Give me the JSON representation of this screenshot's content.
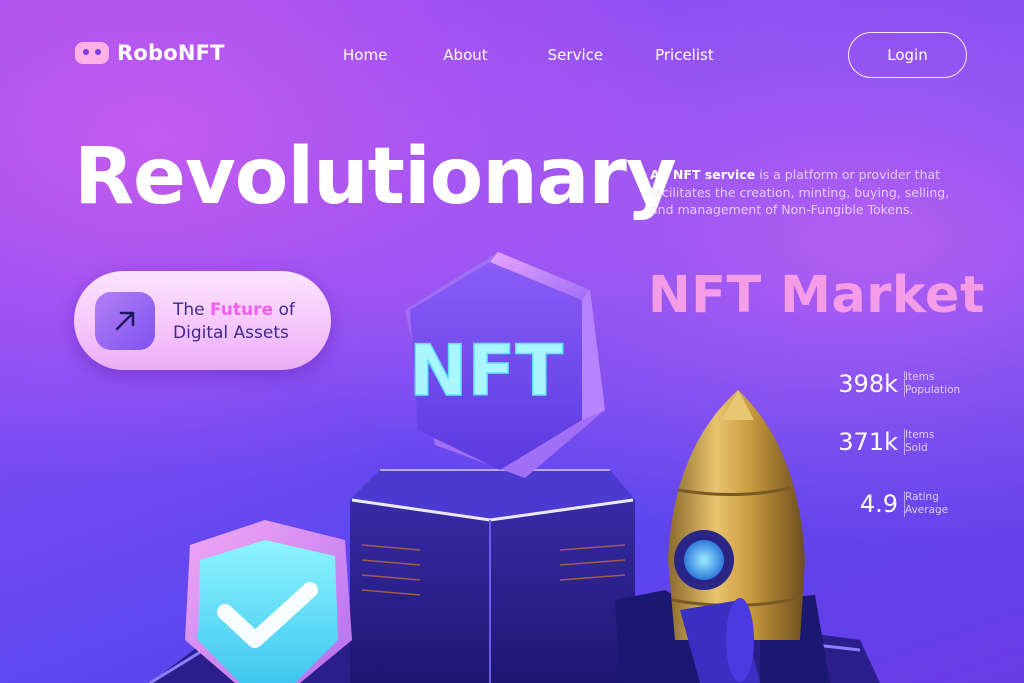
{
  "brand": {
    "name": "RoboNFT",
    "icon": "robot-icon"
  },
  "nav": {
    "items": [
      {
        "label": "Home"
      },
      {
        "label": "About"
      },
      {
        "label": "Service"
      },
      {
        "label": "Pricelist"
      }
    ],
    "login_label": "Login"
  },
  "hero": {
    "title": "Revolutionary",
    "subtitle": "NFT Market",
    "description_bold": "An NFT service",
    "description_rest": " is a platform or provider that facilitates the creation, minting, buying, selling, and management of Non-Fungible Tokens."
  },
  "pill": {
    "icon": "arrow-up-right-icon",
    "line1_pre": "The ",
    "line1_highlight": "Future",
    "line1_post": " of",
    "line2": "Digital Assets"
  },
  "stats": [
    {
      "value": "398k",
      "label_line1": "Items",
      "label_line2": "Population"
    },
    {
      "value": "371k",
      "label_line1": "Items",
      "label_line2": "Sold"
    },
    {
      "value": "4.9",
      "label_line1": "Rating",
      "label_line2": "Average"
    }
  ],
  "illustration": {
    "nft_block_text": "NFT",
    "objects": [
      "nft-hexagon",
      "pedestal",
      "shield-check-icon",
      "rocket"
    ]
  },
  "colors": {
    "accent_pink": "#f59ce8",
    "highlight": "#f25ff0",
    "pill_text": "#3b2a8f"
  }
}
